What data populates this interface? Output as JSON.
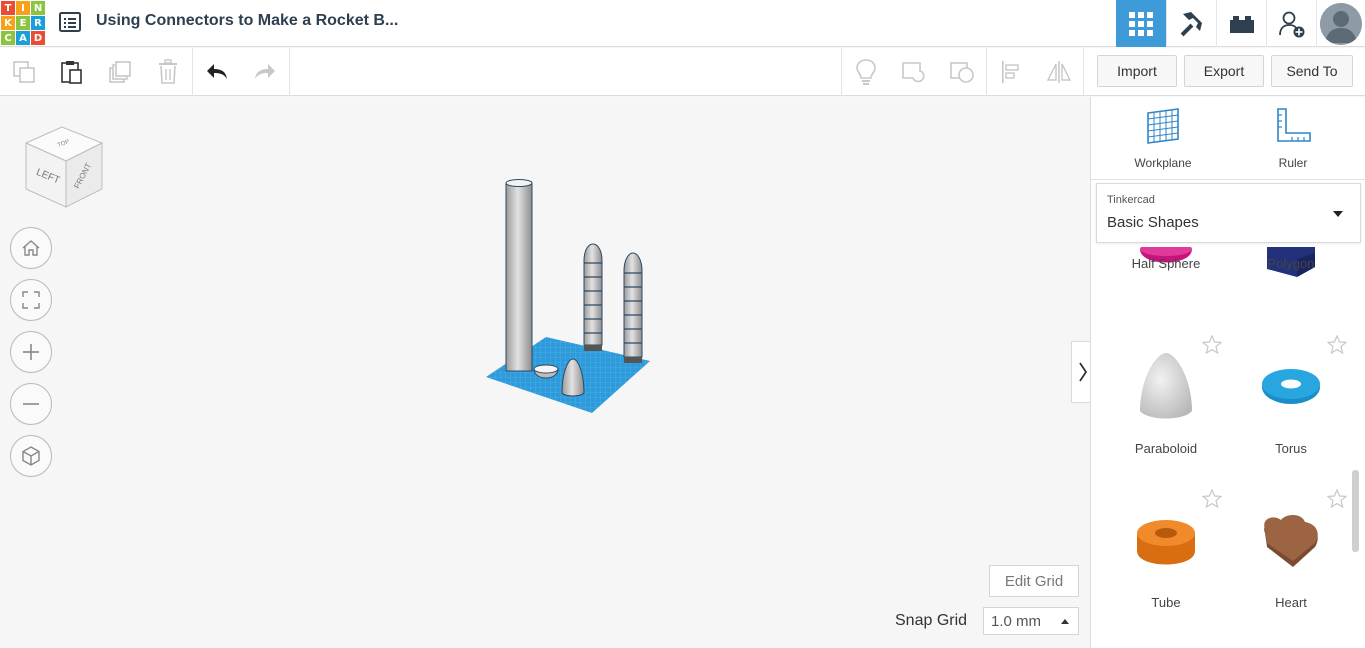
{
  "header": {
    "logo_letters": [
      "T",
      "I",
      "N",
      "K",
      "E",
      "R",
      "C",
      "A",
      "D"
    ],
    "design_title": "Using Connectors to Make a Rocket B...",
    "tools": [
      "grid-view-icon",
      "pickaxe-icon",
      "bricks-icon",
      "add-user-icon"
    ],
    "active_tool": "grid-view-icon"
  },
  "toolbar": {
    "import_label": "Import",
    "export_label": "Export",
    "send_to_label": "Send To"
  },
  "canvas": {
    "view_cube": {
      "left": "LEFT",
      "front": "FRONT",
      "top": "TOP"
    },
    "edit_grid_label": "Edit Grid",
    "snap_grid_label": "Snap Grid",
    "snap_grid_value": "1.0 mm"
  },
  "panel": {
    "workplane_label": "Workplane",
    "ruler_label": "Ruler",
    "library_category": "Tinkercad",
    "library_name": "Basic Shapes",
    "shapes": [
      {
        "name": "Half Sphere",
        "color": "#c8137e"
      },
      {
        "name": "Polygon",
        "color": "#23307c"
      },
      {
        "name": "Paraboloid",
        "color": "#d5d5d5"
      },
      {
        "name": "Torus",
        "color": "#1a8fc7"
      },
      {
        "name": "Tube",
        "color": "#e57a1b"
      },
      {
        "name": "Heart",
        "color": "#8b5a3c"
      }
    ]
  },
  "colors": {
    "accent": "#3f9ad8",
    "grid": "#2d9bdb"
  }
}
